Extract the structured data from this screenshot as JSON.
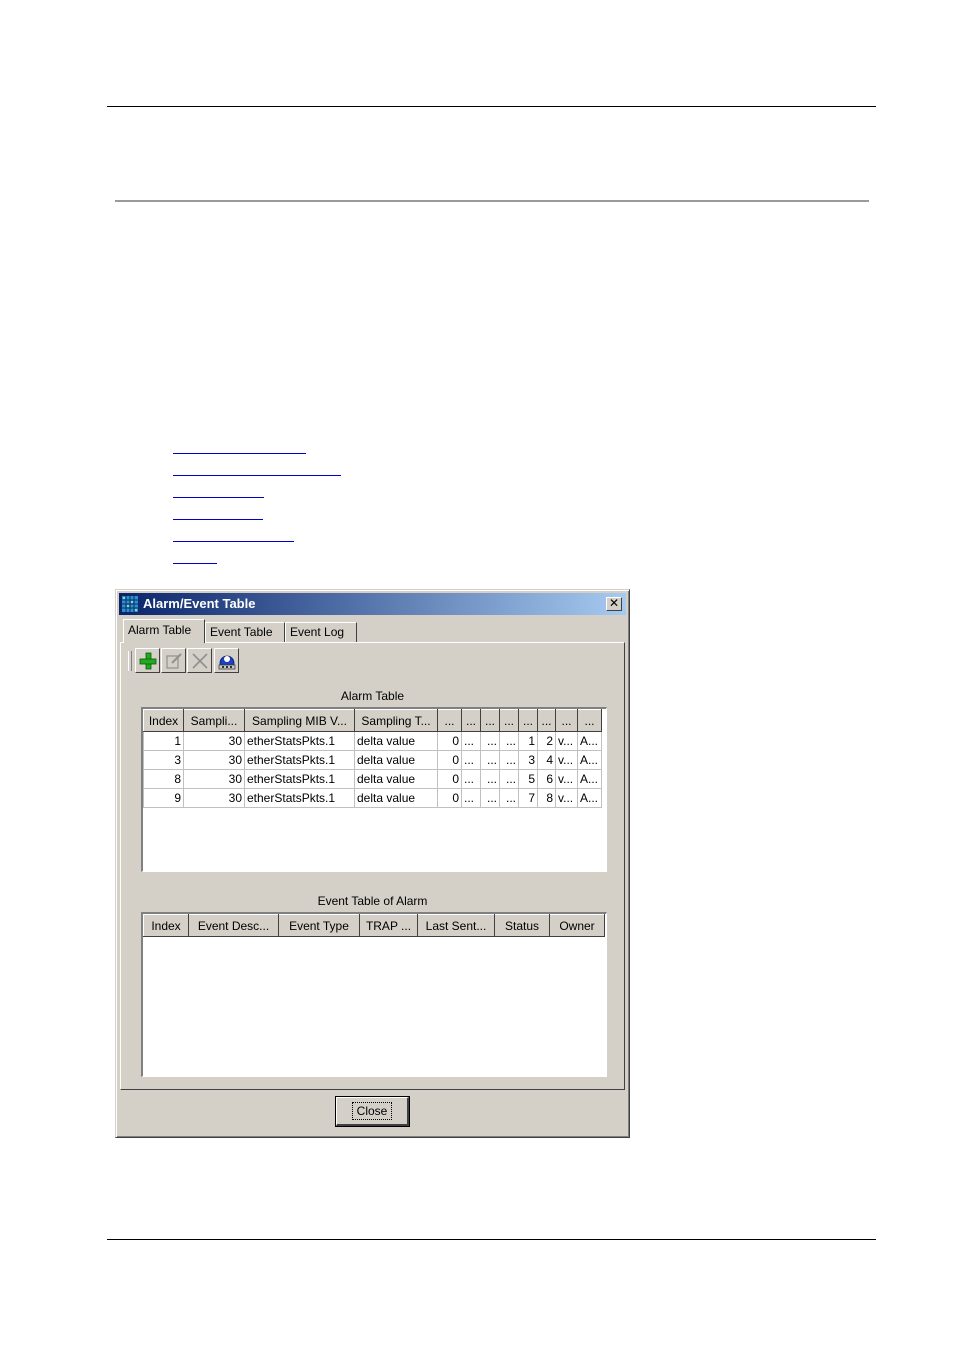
{
  "window": {
    "title": "Alarm/Event Table",
    "close_glyph": "✕",
    "tabs": [
      {
        "label": "Alarm Table",
        "active": true
      },
      {
        "label": "Event Table",
        "active": false
      },
      {
        "label": "Event Log",
        "active": false
      }
    ],
    "toolbar": {
      "icons": [
        "add-icon",
        "edit-icon",
        "delete-icon",
        "refresh-icon"
      ]
    },
    "alarm_table": {
      "caption": "Alarm Table",
      "columns": [
        "Index",
        "Sampli...",
        "Sampling MIB V...",
        "Sampling T...",
        "...",
        "...",
        "...",
        "...",
        "...",
        "...",
        "...",
        "..."
      ],
      "rows": [
        [
          "1",
          "30",
          "etherStatsPkts.1",
          "delta value",
          "0",
          "...",
          "...",
          "...",
          "1",
          "2",
          "v...",
          "A..."
        ],
        [
          "3",
          "30",
          "etherStatsPkts.1",
          "delta value",
          "0",
          "...",
          "...",
          "...",
          "3",
          "4",
          "v...",
          "A..."
        ],
        [
          "8",
          "30",
          "etherStatsPkts.1",
          "delta value",
          "0",
          "...",
          "...",
          "...",
          "5",
          "6",
          "v...",
          "A..."
        ],
        [
          "9",
          "30",
          "etherStatsPkts.1",
          "delta value",
          "0",
          "...",
          "...",
          "...",
          "7",
          "8",
          "v...",
          "A..."
        ]
      ]
    },
    "event_table": {
      "caption": "Event Table of Alarm",
      "columns": [
        "Index",
        "Event Desc...",
        "Event Type",
        "TRAP ...",
        "Last Sent...",
        "Status",
        "Owner"
      ],
      "rows": []
    },
    "close_button": "Close"
  },
  "colors": {
    "title_gradient_start": "#0a246a",
    "title_gradient_end": "#a6caf0",
    "face": "#d4d0c8",
    "link": "#0000cc"
  }
}
